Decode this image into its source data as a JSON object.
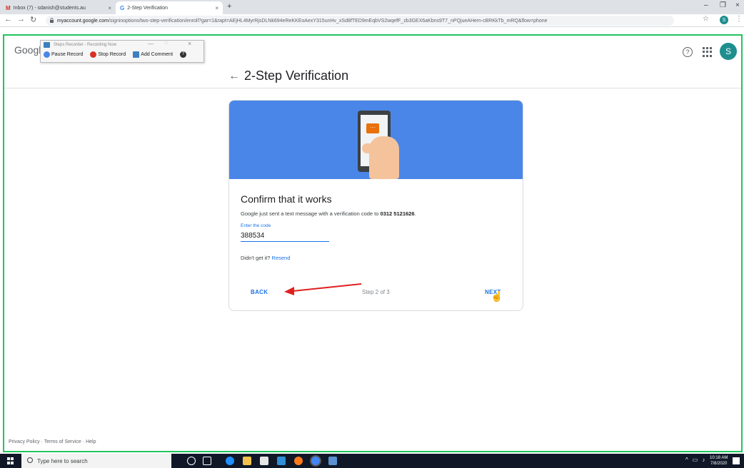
{
  "browser": {
    "tabs": [
      {
        "favicon": "M",
        "label": "Inbox (7) - sdanish@students.au",
        "close": "×"
      },
      {
        "favicon": "G",
        "label": "2-Step Verification",
        "close": "×"
      }
    ],
    "new_tab": "+",
    "window_controls": {
      "minimize": "–",
      "restore": "❐",
      "close": "×"
    },
    "address": {
      "domain": "myaccount.google.com",
      "path": "/signinoptions/two-step-verification/enroll?gar=1&rapt=AEjHL4MyrRjsDLNk694eReKKEoAexY315unHv_xSd8fTED9mEqbVS2wqefF_zb3GEX6aKbns9T7_nPQjueAHem-cBRKkTb_mRQ&flow=phone"
    },
    "profile_initial": "S"
  },
  "page": {
    "logo": "Google",
    "account_initial": "S",
    "back_arrow": "←",
    "title": "2-Step Verification"
  },
  "steps_recorder": {
    "title": "Steps Recorder - Recording Now",
    "pause": "Pause Record",
    "stop": "Stop Record",
    "comment": "Add Comment",
    "help": "?",
    "min": "—",
    "max": "□",
    "close": "×"
  },
  "card": {
    "heading": "Confirm that it works",
    "desc_prefix": "Google just sent a text message with a verification code to ",
    "phone": "0312 5121626",
    "desc_suffix": ".",
    "code_label": "Enter the code",
    "code_value": "388534",
    "resend_prompt": "Didn't get it? ",
    "resend_link": "Resend",
    "back": "BACK",
    "step": "Step 2 of 3",
    "next": "NEXT"
  },
  "footer": {
    "privacy": "Privacy Policy",
    "terms": "Terms of Service",
    "help": "Help",
    "sep": "·"
  },
  "taskbar": {
    "search_placeholder": "Type here to search",
    "time": "10:18 AM",
    "date": "7/8/2020"
  },
  "colors": {
    "accent": "#1a73e8",
    "hero": "#4a86e8",
    "frame": "#22c55e",
    "avatar": "#1e8e8e",
    "annotation_arrow": "#e02020"
  }
}
